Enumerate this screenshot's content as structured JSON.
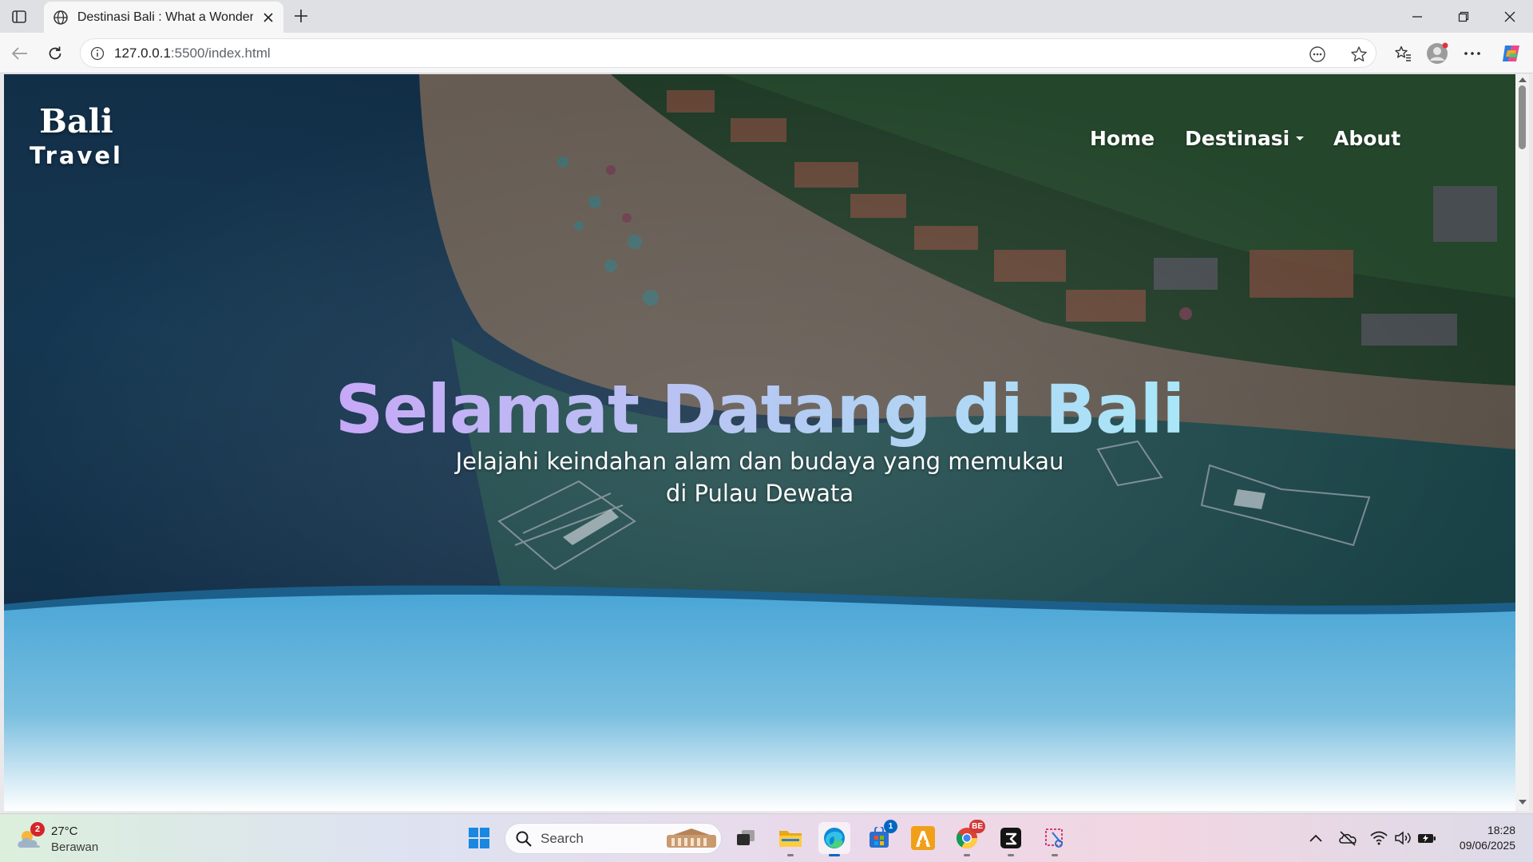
{
  "browser": {
    "tab_title": "Destinasi Bali : What a Wonderful",
    "url_host": "127.0.0.1",
    "url_rest": ":5500/index.html"
  },
  "page": {
    "brand_top": "Bali",
    "brand_bottom": "Travel",
    "nav": {
      "home": "Home",
      "destinasi": "Destinasi",
      "about": "About"
    },
    "hero_title": "Selamat Datang di Bali",
    "hero_sub_line1": "Jelajahi keindahan alam dan budaya yang memukau",
    "hero_sub_line2": "di Pulau Dewata",
    "colors": {
      "title_gradient_start": "#c7a8f7",
      "title_gradient_end": "#a9e7f8",
      "wave": "#4aa6d6"
    }
  },
  "taskbar": {
    "weather": {
      "badge": "2",
      "temp": "27°C",
      "desc": "Berawan"
    },
    "search_placeholder": "Search",
    "badges": {
      "store": "1",
      "chrome": "BE"
    },
    "clock": {
      "time": "18:28",
      "date": "09/06/2025"
    }
  }
}
